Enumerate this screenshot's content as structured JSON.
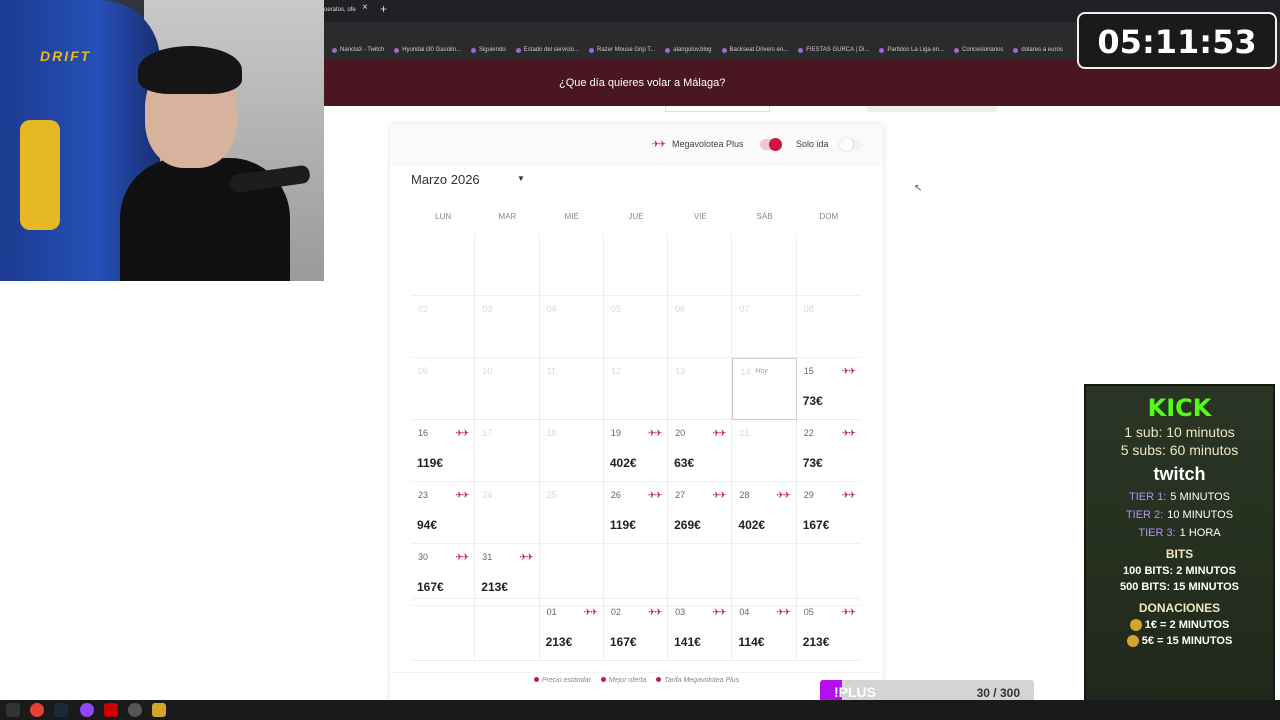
{
  "browser": {
    "tab_title": "oeratos, ofe",
    "tab_close": "×",
    "new_tab": "+",
    "bookmarks": [
      "Nancla3 - Twitch",
      "Hyundai i30 Gasolin...",
      "Siguiendo",
      "Estado del servicio...",
      "Razer Mouse Grip T...",
      "alangulov.blog",
      "Backseat Drivers en...",
      "FIESTAS GURCA | Di...",
      "Partidos La Liga en...",
      "Concesionarios",
      "dolares a euros"
    ]
  },
  "header": {
    "question": "¿Que día quieres volar a Málaga?"
  },
  "options": {
    "megavolotea_label": "Megavolotea Plus",
    "one_way_label": "Solo ida",
    "megavolotea_on": true,
    "one_way_on": false
  },
  "calendar": {
    "month": "Marzo 2026",
    "weekdays": [
      "LUN",
      "MAR",
      "MIÉ",
      "JUE",
      "VIE",
      "SÁB",
      "DOM"
    ],
    "today_label": "Hoy",
    "weeks": [
      [
        {
          "d": ""
        },
        {
          "d": ""
        },
        {
          "d": ""
        },
        {
          "d": ""
        },
        {
          "d": ""
        },
        {
          "d": ""
        },
        {
          "d": ""
        }
      ],
      [
        {
          "d": "02",
          "dis": true
        },
        {
          "d": "03",
          "dis": true
        },
        {
          "d": "04",
          "dis": true
        },
        {
          "d": "05",
          "dis": true
        },
        {
          "d": "06",
          "dis": true
        },
        {
          "d": "07",
          "dis": true
        },
        {
          "d": "08",
          "dis": true
        }
      ],
      [
        {
          "d": "09",
          "dis": true
        },
        {
          "d": "10",
          "dis": true
        },
        {
          "d": "11",
          "dis": true
        },
        {
          "d": "12",
          "dis": true
        },
        {
          "d": "13",
          "dis": true
        },
        {
          "d": "14",
          "dis": true,
          "today": true
        },
        {
          "d": "15",
          "p": "73€",
          "plane": true
        }
      ],
      [
        {
          "d": "16",
          "p": "119€",
          "plane": true
        },
        {
          "d": "17",
          "dis": true
        },
        {
          "d": "18",
          "dis": true
        },
        {
          "d": "19",
          "p": "402€",
          "plane": true
        },
        {
          "d": "20",
          "p": "63€",
          "plane": true
        },
        {
          "d": "21",
          "dis": true
        },
        {
          "d": "22",
          "p": "73€",
          "plane": true
        }
      ],
      [
        {
          "d": "23",
          "p": "94€",
          "plane": true
        },
        {
          "d": "24",
          "dis": true
        },
        {
          "d": "25",
          "dis": true
        },
        {
          "d": "26",
          "p": "119€",
          "plane": true
        },
        {
          "d": "27",
          "p": "269€",
          "plane": true
        },
        {
          "d": "28",
          "p": "402€",
          "plane": true
        },
        {
          "d": "29",
          "p": "167€",
          "plane": true
        }
      ],
      [
        {
          "d": "30",
          "p": "167€",
          "plane": true
        },
        {
          "d": "31",
          "p": "213€",
          "plane": true
        },
        {
          "d": ""
        },
        {
          "d": ""
        },
        {
          "d": ""
        },
        {
          "d": ""
        },
        {
          "d": ""
        }
      ]
    ],
    "next_week": [
      {
        "d": ""
      },
      {
        "d": ""
      },
      {
        "d": "01",
        "p": "213€",
        "plane": true
      },
      {
        "d": "02",
        "p": "167€",
        "plane": true
      },
      {
        "d": "03",
        "p": "141€",
        "plane": true
      },
      {
        "d": "04",
        "p": "114€",
        "plane": true
      },
      {
        "d": "05",
        "p": "213€",
        "plane": true
      }
    ],
    "legend": [
      "Precio estándar",
      "Mejor oferta",
      "Tarifa Megavolotea Plus"
    ]
  },
  "timer": "05:11:53",
  "webcam": {
    "chair_brand": "DRIFT"
  },
  "subpanel": {
    "kick": "KICK",
    "kick_1": "1 sub: 10 minutos",
    "kick_5": "5 subs: 60 minutos",
    "twitch": "twitch",
    "tier1_name": "TIER 1:",
    "tier1_val": "5 MINUTOS",
    "tier2_name": "TIER 2:",
    "tier2_val": "10 MINUTOS",
    "tier3_name": "TIER 3:",
    "tier3_val": "1 HORA",
    "bits": "BITS",
    "bits_100": "100 BITS: 2 MINUTOS",
    "bits_500": "500 BITS: 15 MINUTOS",
    "donations": "DONACIONES",
    "don_1": "1€ = 2 MINUTOS",
    "don_5": "5€ = 15 MINUTOS"
  },
  "plus": {
    "label": "!PLUS",
    "count": "30 / 300"
  },
  "colors": {
    "brand": "#4a1622",
    "accent": "#d31244",
    "kick": "#53fc18",
    "plus": "#b50ff0"
  }
}
